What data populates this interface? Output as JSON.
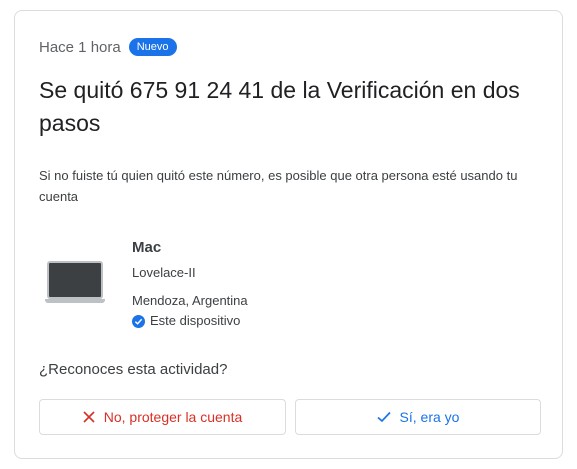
{
  "header": {
    "time": "Hace 1 hora",
    "badge": "Nuevo"
  },
  "title": "Se quitó 675 91 24 41 de la Verificación en dos pasos",
  "description": "Si no fuiste tú quien quitó este número, es posible que otra persona esté usando tu cuenta",
  "device": {
    "icon": "laptop-icon",
    "name": "Mac",
    "model": "Lovelace-II",
    "location": "Mendoza, Argentina",
    "this_device": "Este dispositivo"
  },
  "question": "¿Reconoces esta actividad?",
  "actions": {
    "no_label": "No, proteger la cuenta",
    "yes_label": "Sí, era yo"
  },
  "colors": {
    "accent": "#1a73e8",
    "danger": "#d93025",
    "border": "#dadce0"
  }
}
